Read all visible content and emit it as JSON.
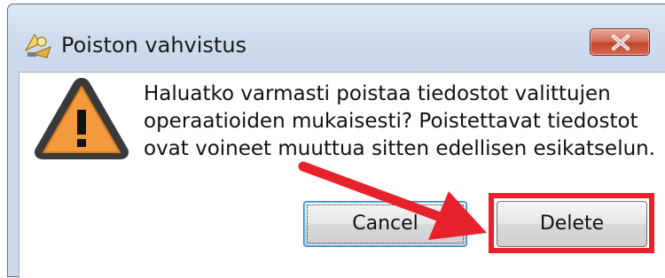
{
  "window": {
    "title": "Poiston vahvistus",
    "icon": "app-icon",
    "close_icon": "close-icon"
  },
  "dialog": {
    "icon": "warning-icon",
    "message_lines": [
      "Haluatko varmasti poistaa tiedostot valittujen",
      "operaatioiden mukaisesti? Poistettavat tiedostot",
      "ovat voineet muuttua sitten edellisen esikatselun."
    ]
  },
  "buttons": {
    "cancel_label": "Cancel",
    "delete_label": "Delete"
  },
  "annotation": {
    "color": "#e8222b"
  }
}
